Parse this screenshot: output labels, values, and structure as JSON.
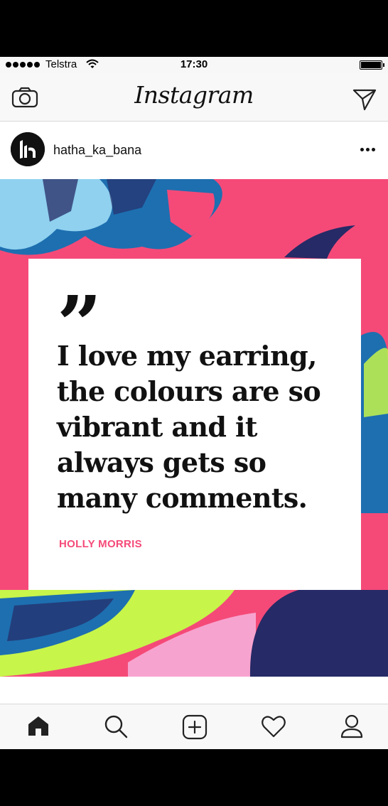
{
  "status_bar": {
    "carrier": "Telstra",
    "time": "17:30"
  },
  "header": {
    "logo_text": "Instagram",
    "left_icon": "camera-icon",
    "right_icon": "send-icon"
  },
  "post": {
    "username": "hatha_ka_bana",
    "avatar_icon": "brand-logo",
    "more_icon": "more-icon",
    "quote_mark": "”",
    "quote_text": "I love my earring, the colours are so vibrant and it always gets so many comments.",
    "author": "HOLLY MORRIS",
    "colors": {
      "pink": "#f54a78",
      "navy": "#262a66",
      "blue": "#1d6fb0",
      "light_blue": "#8fd1ef",
      "lime": "#c7f54a",
      "light_pink": "#f7a3cf"
    }
  },
  "tab_bar": {
    "tabs": [
      "home-icon",
      "search-icon",
      "add-post-icon",
      "heart-icon",
      "profile-icon"
    ]
  }
}
